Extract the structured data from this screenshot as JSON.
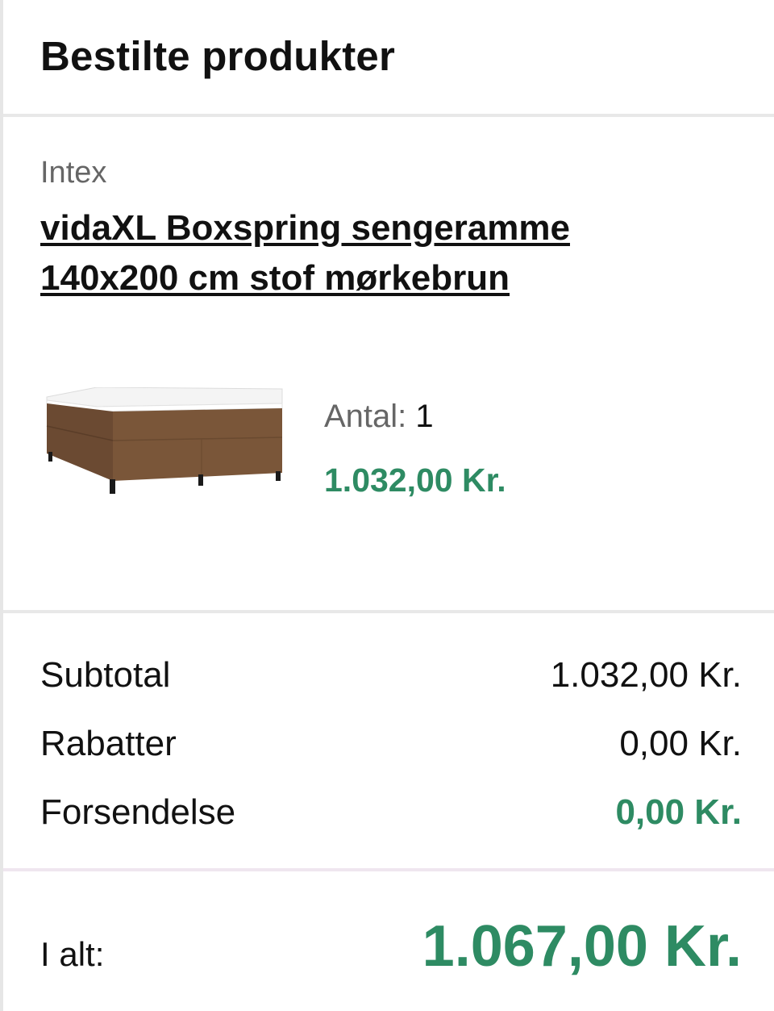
{
  "section": {
    "title": "Bestilte produkter"
  },
  "product": {
    "brand": "Intex",
    "title": "vidaXL Boxspring sengeramme 140x200 cm stof mørkebrun",
    "image_icon": "boxspring-bed-icon",
    "quantity_label": "Antal:",
    "quantity_value": "1",
    "price": "1.032,00 Kr."
  },
  "totals": {
    "subtotal_label": "Subtotal",
    "subtotal_value": "1.032,00 Kr.",
    "discount_label": "Rabatter",
    "discount_value": "0,00 Kr.",
    "shipping_label": "Forsendelse",
    "shipping_value": "0,00 Kr.",
    "total_label": "I alt:",
    "total_value": "1.067,00 Kr."
  },
  "colors": {
    "accent_green": "#2e8b63",
    "divider": "#e8e8e8",
    "muted_text": "#666666"
  }
}
